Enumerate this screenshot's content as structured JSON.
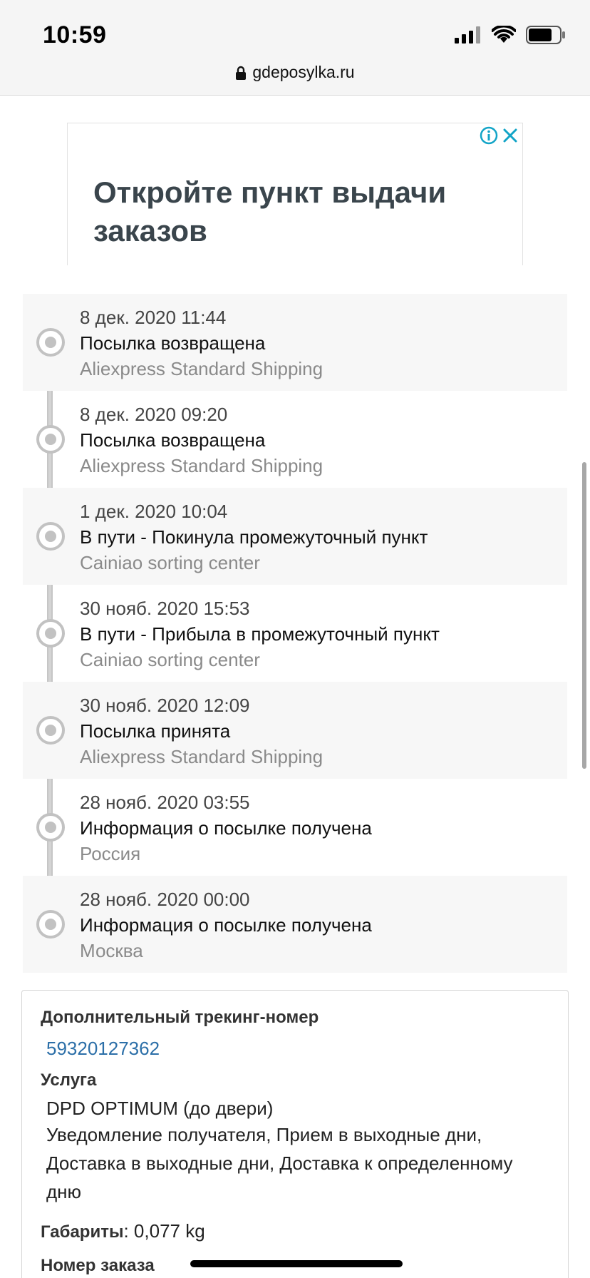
{
  "status_bar": {
    "time": "10:59"
  },
  "browser": {
    "url": "gdeposylka.ru"
  },
  "ad": {
    "headline": "Откройте пункт выдачи заказов"
  },
  "timeline": [
    {
      "date": "8 дек. 2020 11:44",
      "status": "Посылка возвращена",
      "place": "Aliexpress Standard Shipping"
    },
    {
      "date": "8 дек. 2020 09:20",
      "status": "Посылка возвращена",
      "place": "Aliexpress Standard Shipping"
    },
    {
      "date": "1 дек. 2020 10:04",
      "status": "В пути - Покинула промежуточный пункт",
      "place": "Cainiao sorting center"
    },
    {
      "date": "30 нояб. 2020 15:53",
      "status": "В пути - Прибыла в промежуточный пункт",
      "place": "Cainiao sorting center"
    },
    {
      "date": "30 нояб. 2020 12:09",
      "status": "Посылка принята",
      "place": "Aliexpress Standard Shipping"
    },
    {
      "date": "28 нояб. 2020 03:55",
      "status": "Информация о посылке получена",
      "place": "Россия"
    },
    {
      "date": "28 нояб. 2020 00:00",
      "status": "Информация о посылке получена",
      "place": "Москва"
    }
  ],
  "details": {
    "extra_tracking_label": "Дополнительный трекинг-номер",
    "extra_tracking_number": "59320127362",
    "service_label": "Услуга",
    "service_name": "DPD OPTIMUM (до двери)",
    "service_extras": "Уведомление получателя, Прием в выходные дни, Доставка в выходные дни, Доставка к определенному дню",
    "dimensions_label": "Габариты",
    "dimensions_value": ": 0,077 kg",
    "order_number_label": "Номер заказа"
  }
}
